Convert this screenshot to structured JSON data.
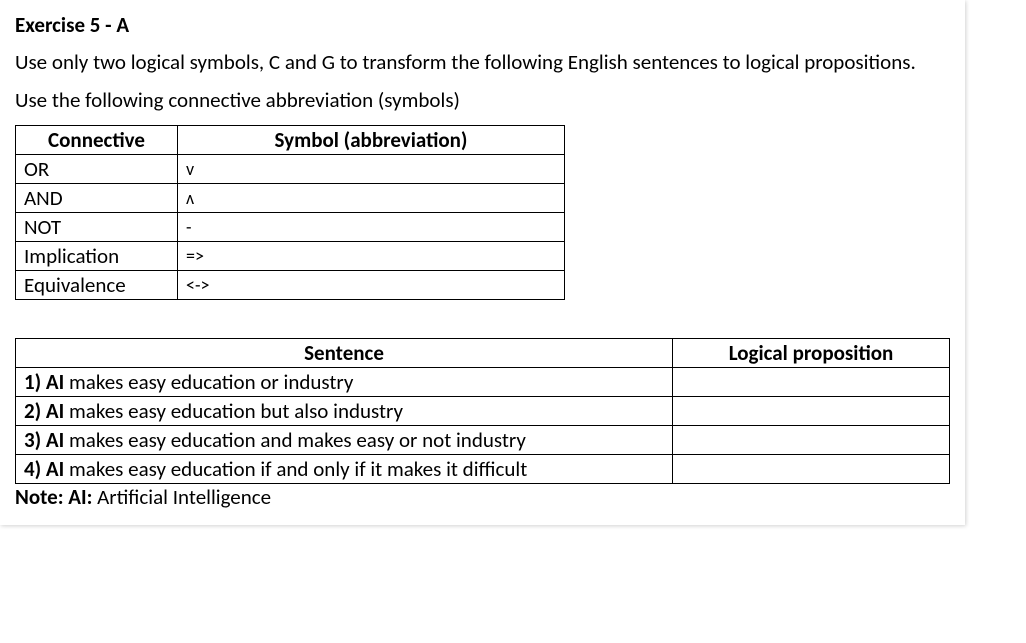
{
  "title": "Exercise 5 - A",
  "intro1": "Use only two logical symbols, C and G to transform the following English sentences to logical propositions.",
  "intro2": "Use the following connective abbreviation (symbols)",
  "connTable": {
    "headers": {
      "connective": "Connective",
      "symbol": "Symbol (abbreviation)"
    },
    "rows": [
      {
        "connective": "OR",
        "symbol": "v"
      },
      {
        "connective": "AND",
        "symbol": "ʌ"
      },
      {
        "connective": "NOT",
        "symbol": "-"
      },
      {
        "connective": "Implication",
        "symbol": "=>"
      },
      {
        "connective": "Equivalence",
        "symbol": "<->"
      }
    ]
  },
  "sentTable": {
    "headers": {
      "sentence": "Sentence",
      "proposition": "Logical proposition"
    },
    "rows": [
      {
        "num": "1) AI",
        "text": " makes easy education or industry",
        "prop": ""
      },
      {
        "num": "2) AI",
        "text": " makes easy education but also industry",
        "prop": ""
      },
      {
        "num": "3) AI",
        "text": " makes easy education and makes easy or not industry",
        "prop": ""
      },
      {
        "num": "4) AI",
        "text": " makes easy education if and only if it makes it difficult",
        "prop": ""
      }
    ]
  },
  "note": {
    "label": "Note: AI:",
    "text": "  Artificial Intelligence"
  }
}
